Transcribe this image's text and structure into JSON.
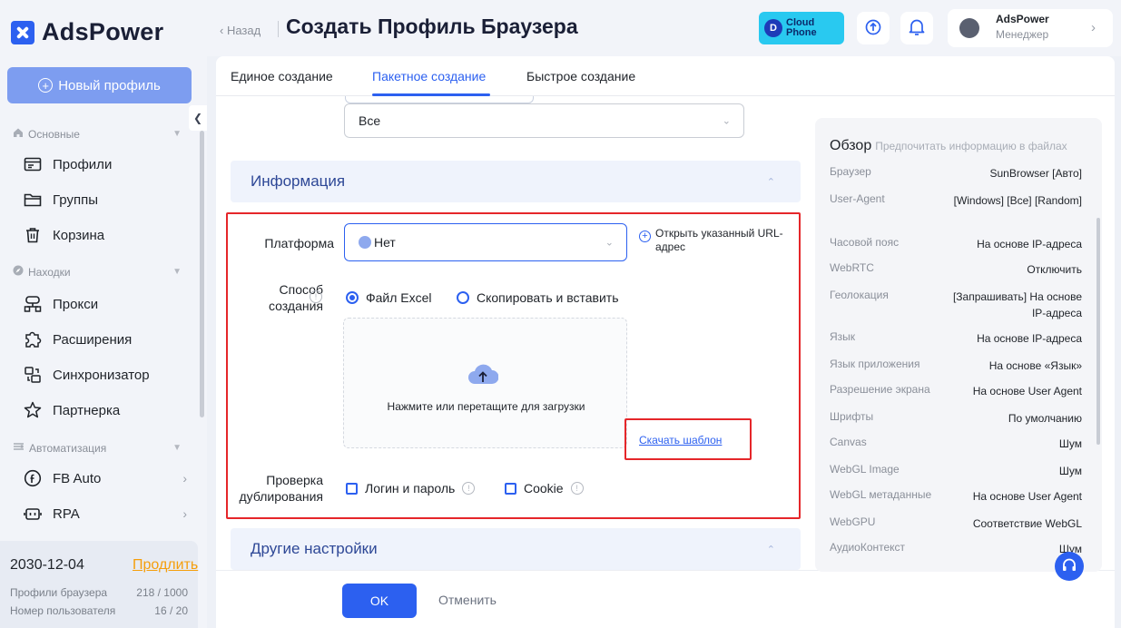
{
  "sidebar": {
    "logo_text": "AdsPower",
    "new_profile_label": "Новый профиль",
    "sections": [
      {
        "title": "Основные",
        "items": [
          {
            "label": "Профили"
          },
          {
            "label": "Группы"
          },
          {
            "label": "Корзина"
          }
        ]
      },
      {
        "title": "Находки",
        "items": [
          {
            "label": "Прокси"
          },
          {
            "label": "Расширения"
          },
          {
            "label": "Синхронизатор"
          },
          {
            "label": "Партнерка"
          }
        ]
      },
      {
        "title": "Автоматизация",
        "items": [
          {
            "label": "FB Auto"
          },
          {
            "label": "RPA"
          }
        ]
      }
    ],
    "account": {
      "expiry_date": "2030-12-04",
      "extend_label": "Продлить",
      "profiles_label": "Профили браузера",
      "profiles_value": "218 / 1000",
      "users_label": "Номер пользователя",
      "users_value": "16 / 20"
    }
  },
  "header": {
    "back_label": "Назад",
    "title": "Создать Профиль Браузера",
    "cloud_phone_line1": "Cloud",
    "cloud_phone_line2": "Phone",
    "user_name": "AdsPower",
    "user_role": "Менеджер"
  },
  "tabs": [
    {
      "label": "Единое создание",
      "active": false
    },
    {
      "label": "Пакетное создание",
      "active": true
    },
    {
      "label": "Быстрое создание",
      "active": false
    }
  ],
  "form": {
    "top_select_value": "Все",
    "info_section_title": "Информация",
    "platform_label": "Платформа",
    "platform_value": "Нет",
    "open_url_label": "Открыть указанный URL-адрес",
    "creation_method_label": "Способ создания",
    "method_excel": "Файл Excel",
    "method_copy": "Скопировать и вставить",
    "upload_text": "Нажмите или перетащите для загрузки",
    "download_template": "Скачать шаблон",
    "duplicate_check_label": "Проверка дублирования",
    "check_login": "Логин и пароль",
    "check_cookie": "Cookie",
    "other_settings_title": "Другие настройки"
  },
  "footer": {
    "ok_label": "OK",
    "cancel_label": "Отменить"
  },
  "overview": {
    "title": "Обзор",
    "subtitle": "Предпочитать информацию в файлах",
    "rows": [
      {
        "key": "Браузер",
        "value": "SunBrowser [Авто]"
      },
      {
        "key": "User-Agent",
        "value": "[Windows] [Все] [Random]"
      },
      {
        "key": "Часовой пояс",
        "value": "На основе IP-адреса"
      },
      {
        "key": "WebRTC",
        "value": "Отключить"
      },
      {
        "key": "Геолокация",
        "value": "[Запрашивать] На основе IP-адреса"
      },
      {
        "key": "Язык",
        "value": "На основе IP-адреса"
      },
      {
        "key": "Язык приложения",
        "value": "На основе «Язык»"
      },
      {
        "key": "Разрешение экрана",
        "value": "На основе User Agent"
      },
      {
        "key": "Шрифты",
        "value": "По умолчанию"
      },
      {
        "key": "Canvas",
        "value": "Шум"
      },
      {
        "key": "WebGL Image",
        "value": "Шум"
      },
      {
        "key": "WebGL метаданные",
        "value": "На основе User Agent"
      },
      {
        "key": "WebGPU",
        "value": "Соответствие WebGL"
      },
      {
        "key": "АудиоКонтекст",
        "value": "Шум"
      }
    ]
  },
  "colors": {
    "accent": "#2c60f0",
    "highlight_red": "#e5262a",
    "extend_orange": "#f59e0b"
  }
}
